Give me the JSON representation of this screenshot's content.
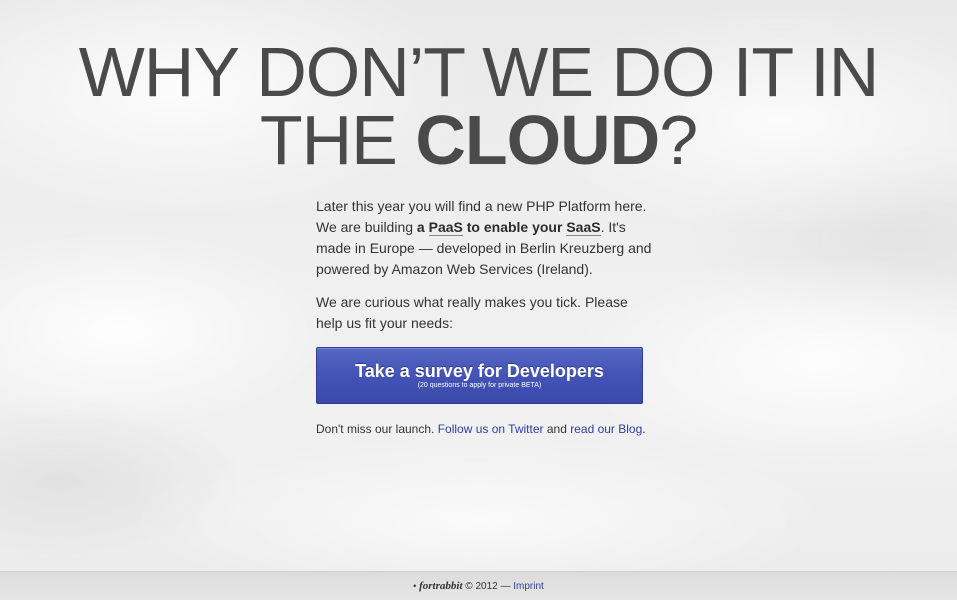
{
  "headline": {
    "line1": "WHY DON’T WE DO IT IN",
    "line2_prefix": "THE",
    "line2_bold": "CLOUD",
    "line2_suffix": "?"
  },
  "intro": {
    "part1": "Later this year you will find a new PHP Platform here. We are building ",
    "bold_a": "a ",
    "highlight_paas": "PaaS",
    "bold_middle": " to enable your ",
    "highlight_saas": "SaaS",
    "part2": ". It's made in Europe — developed in Berlin Kreuzberg and powered by Amazon Web Services (Ireland)."
  },
  "curious_text": "We are curious what really makes you tick. Please help us fit your needs:",
  "survey_button": {
    "label": "Take a survey for Developers",
    "sublabel": "(20 questions to apply for private BETA)"
  },
  "launch": {
    "prefix": "Don't miss our launch. ",
    "twitter_link": "Follow us on Twitter",
    "middle": " and ",
    "blog_link": "read our Blog",
    "suffix": "."
  },
  "footer": {
    "bullet": "•",
    "brand": "fortrabbit",
    "copyright": " © 2012 — ",
    "imprint_link": "Imprint"
  },
  "colors": {
    "button": "#4454b6",
    "link": "#2d3f9e",
    "headline": "#4a4a4a"
  }
}
